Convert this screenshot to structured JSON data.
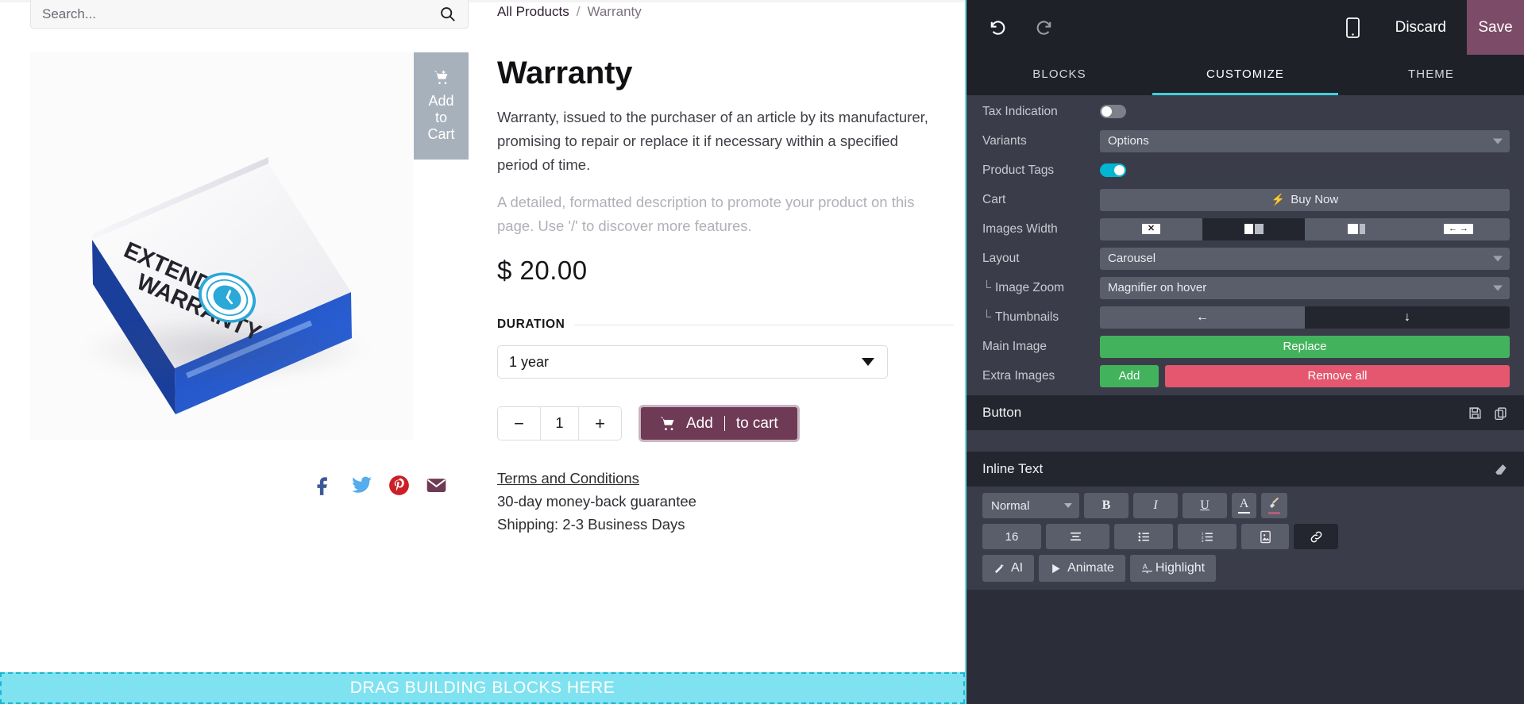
{
  "preview": {
    "search": {
      "placeholder": "Search...",
      "value": "",
      "icon": "search-icon"
    },
    "breadcrumb": {
      "root": "All Products",
      "separator": "/",
      "current": "Warranty"
    },
    "floating_cart": {
      "line1": "Add",
      "line2": "to",
      "line3": "Cart",
      "icon": "cart-plus-icon"
    },
    "product": {
      "title": "Warranty",
      "description": "Warranty, issued to the purchaser of an article by its manufacturer, promising to repair or replace it if necessary within a specified period of time.",
      "description_placeholder": "A detailed, formatted description to promote your product on this page. Use '/' to discover more features.",
      "price": "$ 20.00",
      "image_alt_line1": "EXTENDED",
      "image_alt_line2": "WARRANTY"
    },
    "variant": {
      "label": "DURATION",
      "selected": "1 year"
    },
    "quantity": {
      "decrement": "−",
      "value": "1",
      "increment": "+"
    },
    "add_to_cart": {
      "label_before_caret": "Add ",
      "label_after_caret": "to cart",
      "icon": "cart-icon"
    },
    "links": {
      "terms": "Terms and Conditions",
      "guarantee": "30-day money-back guarantee",
      "shipping": "Shipping: 2-3 Business Days"
    },
    "socials": [
      {
        "name": "facebook-icon",
        "color": "#3b5998"
      },
      {
        "name": "twitter-icon",
        "color": "#55acee"
      },
      {
        "name": "pinterest-icon",
        "color": "#cb2027"
      },
      {
        "name": "email-icon",
        "color": "#6f3a55"
      }
    ],
    "drop_zone": "DRAG BUILDING BLOCKS HERE"
  },
  "editor": {
    "toolbar": {
      "undo": "undo-icon",
      "redo": "redo-icon",
      "mobile_preview": "mobile-icon",
      "discard_label": "Discard",
      "save_label": "Save"
    },
    "tabs": [
      {
        "label": "BLOCKS",
        "active": false
      },
      {
        "label": "CUSTOMIZE",
        "active": true
      },
      {
        "label": "THEME",
        "active": false
      }
    ],
    "options": [
      {
        "label": "Tax Indication",
        "type": "toggle",
        "value": "off"
      },
      {
        "label": "Variants",
        "type": "select",
        "value": "Options"
      },
      {
        "label": "Product Tags",
        "type": "toggle",
        "value": "on"
      },
      {
        "label": "Cart",
        "type": "button",
        "value": "Buy Now"
      },
      {
        "label": "Images Width",
        "type": "segmented",
        "active_index": 1
      },
      {
        "label": "Layout",
        "type": "select",
        "value": "Carousel"
      },
      {
        "label": "Image Zoom",
        "type": "select",
        "value": "Magnifier on hover",
        "sub": true
      },
      {
        "label": "Thumbnails",
        "type": "segmented2",
        "active_index": 1,
        "sub": true
      },
      {
        "label": "Main Image",
        "type": "green-button",
        "value": "Replace"
      },
      {
        "label": "Extra Images",
        "type": "green-red",
        "value": "Add",
        "value2": "Remove all"
      }
    ],
    "button_section": {
      "title": "Button",
      "icons": [
        "save-icon",
        "copy-icon"
      ]
    },
    "inline_text_section": {
      "title": "Inline Text",
      "icon": "eraser-icon",
      "style_value": "Normal",
      "bold": "B",
      "italic": "I",
      "underline": "U",
      "font_color": "A",
      "brush": "brush-icon",
      "font_size": "16",
      "align": "align-icon",
      "bullet_list": "bullet-list-icon",
      "numbered_list": "numbered-list-icon",
      "image": "image-icon",
      "link": "link-icon",
      "ai_label": "AI",
      "animate_label": "Animate",
      "highlight_label": "Highlight"
    },
    "colors": {
      "accent": "#3fd0e0",
      "save_bg": "#7b4b67",
      "panel_bg": "#2b2d38",
      "green": "#42b35c",
      "red": "#e4576f"
    }
  }
}
